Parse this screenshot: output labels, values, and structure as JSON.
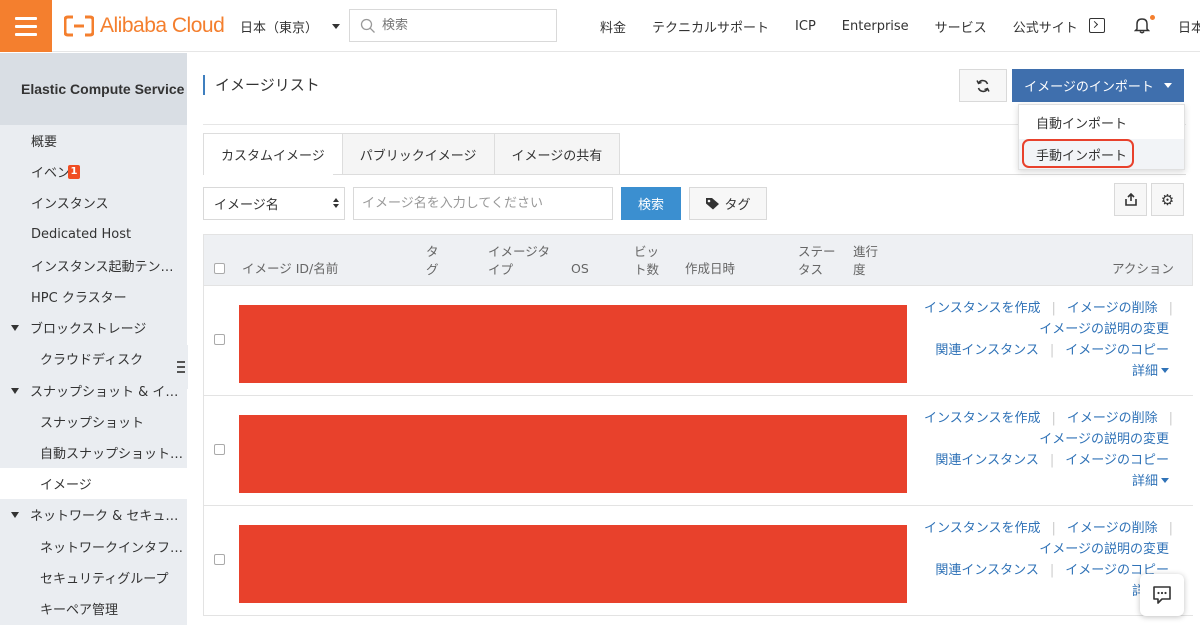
{
  "header": {
    "logo_text": "Alibaba Cloud",
    "region": "日本（東京）",
    "search_placeholder": "検索",
    "nav": [
      "料金",
      "テクニカルサポート",
      "ICP",
      "Enterprise",
      "サービス",
      "公式サイト"
    ],
    "language": "日本",
    "accent_color": "#f47f2e"
  },
  "sidebar": {
    "title": "Elastic Compute Service",
    "items": [
      {
        "label": "概要",
        "type": "item"
      },
      {
        "label": "イベン",
        "type": "item",
        "badge": "1"
      },
      {
        "label": "インスタンス",
        "type": "item"
      },
      {
        "label": "Dedicated Host",
        "type": "item"
      },
      {
        "label": "インスタンス起動テン…",
        "type": "item"
      },
      {
        "label": "HPC クラスター",
        "type": "item"
      },
      {
        "label": "ブロックストレージ",
        "type": "group"
      },
      {
        "label": "クラウドディスク",
        "type": "subitem"
      },
      {
        "label": "スナップショット & イ…",
        "type": "group"
      },
      {
        "label": "スナップショット",
        "type": "subitem"
      },
      {
        "label": "自動スナップショット…",
        "type": "subitem"
      },
      {
        "label": "イメージ",
        "type": "subitem",
        "active": true
      },
      {
        "label": "ネットワーク & セキュ…",
        "type": "group"
      },
      {
        "label": "ネットワークインタフ…",
        "type": "subitem"
      },
      {
        "label": "セキュリティグループ",
        "type": "subitem"
      },
      {
        "label": "キーペア管理",
        "type": "subitem"
      }
    ]
  },
  "main": {
    "page_title": "イメージリスト",
    "import_button": "イメージのインポート",
    "import_menu": [
      "自動インポート",
      "手動インポート"
    ],
    "tabs": [
      "カスタムイメージ",
      "パブリックイメージ",
      "イメージの共有"
    ],
    "filter_select": "イメージ名",
    "filter_placeholder": "イメージ名を入力してください",
    "search_button": "検索",
    "tag_button": "タグ",
    "table": {
      "headers": {
        "id_name": "イメージ ID/名前",
        "tag": "タ\nグ",
        "image_type": "イメージタ\nイプ",
        "os": "OS",
        "bits": "ビッ\nト数",
        "created": "作成日時",
        "status": "ステー\nタス",
        "progress": "進行\n度",
        "actions": "アクション"
      },
      "rows": [
        {
          "actions": {
            "create": "インスタンスを作成",
            "delete": "イメージの削除",
            "edit_desc": "イメージの説明の変更",
            "related": "関連インスタンス",
            "copy": "イメージのコピー",
            "details": "詳細"
          }
        },
        {
          "actions": {
            "create": "インスタンスを作成",
            "delete": "イメージの削除",
            "edit_desc": "イメージの説明の変更",
            "related": "関連インスタンス",
            "copy": "イメージのコピー",
            "details": "詳細"
          }
        },
        {
          "actions": {
            "create": "インスタンスを作成",
            "delete": "イメージの削除",
            "edit_desc": "イメージの説明の変更",
            "related": "関連インスタンス",
            "copy": "イメージのコピー",
            "details": "詳細"
          }
        }
      ]
    }
  }
}
